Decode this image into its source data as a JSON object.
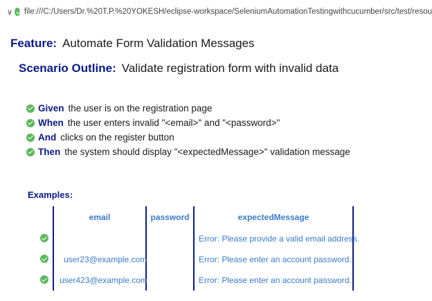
{
  "address_bar": {
    "path": "file:///C:/Users/Dr.%20T.P.%20YOKESH/eclipse-workspace/SeleniumAutomationTestingwithcucumber/src/test/resou"
  },
  "feature": {
    "keyword": "Feature:",
    "title": "Automate Form Validation Messages"
  },
  "scenario": {
    "keyword": "Scenario Outline:",
    "title": "Validate registration form with invalid data"
  },
  "steps": [
    {
      "keyword": "Given",
      "text": "the user is on the registration page"
    },
    {
      "keyword": "When",
      "text": "the user enters invalid \"<email>\" and \"<password>\""
    },
    {
      "keyword": "And",
      "text": "clicks on the register button"
    },
    {
      "keyword": "Then",
      "text": "the system should display \"<expectedMessage>\" validation message"
    }
  ],
  "examples": {
    "title": "Examples:",
    "headers": [
      "email",
      "password",
      "expectedMessage"
    ],
    "rows": [
      {
        "email": "",
        "password": "",
        "expectedMessage": "Error: Please provide a valid email address."
      },
      {
        "email": "user23@example.com",
        "password": "",
        "expectedMessage": "Error: Please enter an account password."
      },
      {
        "email": "user423@example.com",
        "password": "",
        "expectedMessage": "Error: Please enter an account password."
      }
    ]
  },
  "colors": {
    "keyword": "#0a1a86",
    "pass": "#5cb85c",
    "table_text": "#3a7bc8"
  }
}
